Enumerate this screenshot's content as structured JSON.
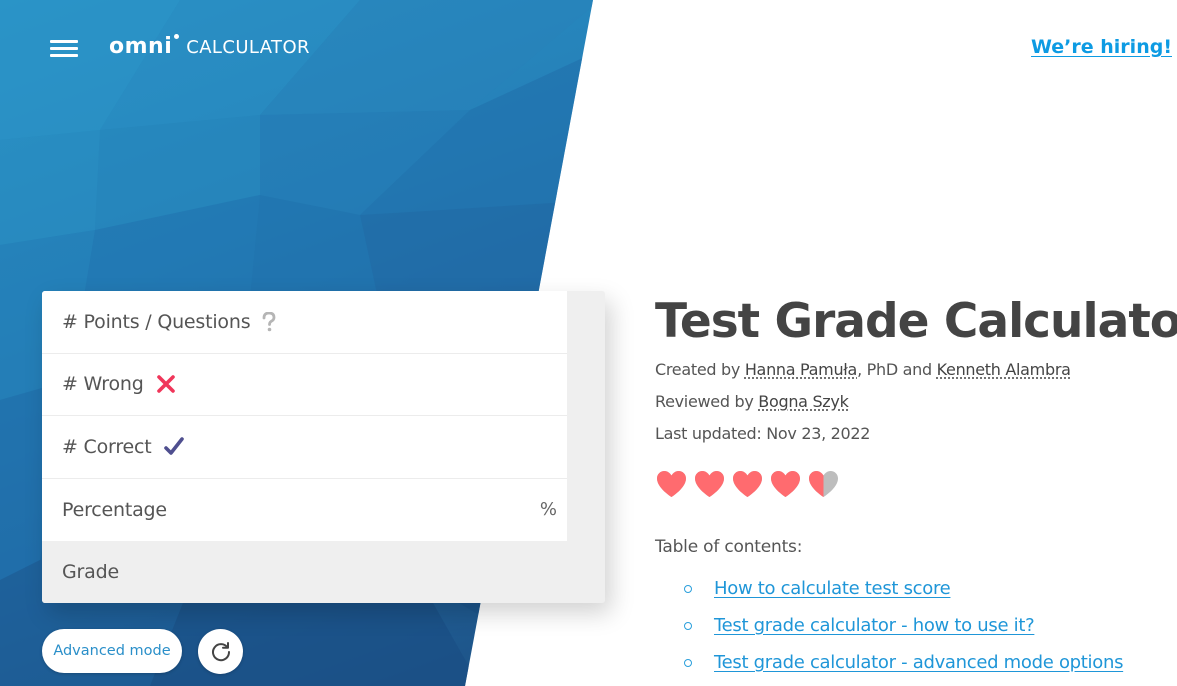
{
  "header": {
    "menu_icon": "hamburger-menu-icon",
    "logo_brand": "omni",
    "logo_product": "CALCULATOR",
    "hiring_link": "We’re hiring!"
  },
  "calculator": {
    "fields": [
      {
        "label": "# Points / Questions",
        "icon": "question-mark-icon",
        "value": "",
        "unit": ""
      },
      {
        "label": "# Wrong",
        "icon": "cross-icon",
        "value": "",
        "unit": ""
      },
      {
        "label": "# Correct",
        "icon": "checkmark-icon",
        "value": "",
        "unit": ""
      },
      {
        "label": "Percentage",
        "icon": "",
        "value": "",
        "unit": "%"
      },
      {
        "label": "Grade",
        "icon": "",
        "value": "",
        "unit": ""
      }
    ],
    "advanced_mode_label": "Advanced mode",
    "reset_icon": "refresh-icon"
  },
  "article": {
    "title": "Test Grade Calculator",
    "created_prefix": "Created by ",
    "author1": "Hanna Pamuła",
    "author1_suffix": ", PhD and ",
    "author2": "Kenneth Alambra",
    "reviewed_prefix": "Reviewed by ",
    "reviewer": "Bogna Szyk",
    "last_updated": "Last updated: Nov 23, 2022",
    "rating": {
      "value": 4.5,
      "max": 5
    },
    "toc_label": "Table of contents:",
    "toc": [
      "How to calculate test score",
      "Test grade calculator - how to use it?",
      "Test grade calculator - advanced mode options"
    ]
  },
  "colors": {
    "brand_blue": "#2580b8",
    "link_blue": "#1f96d8",
    "heart_red": "#ff6b6f",
    "cross_red": "#f0365a",
    "check_purple": "#4f4f8f"
  }
}
